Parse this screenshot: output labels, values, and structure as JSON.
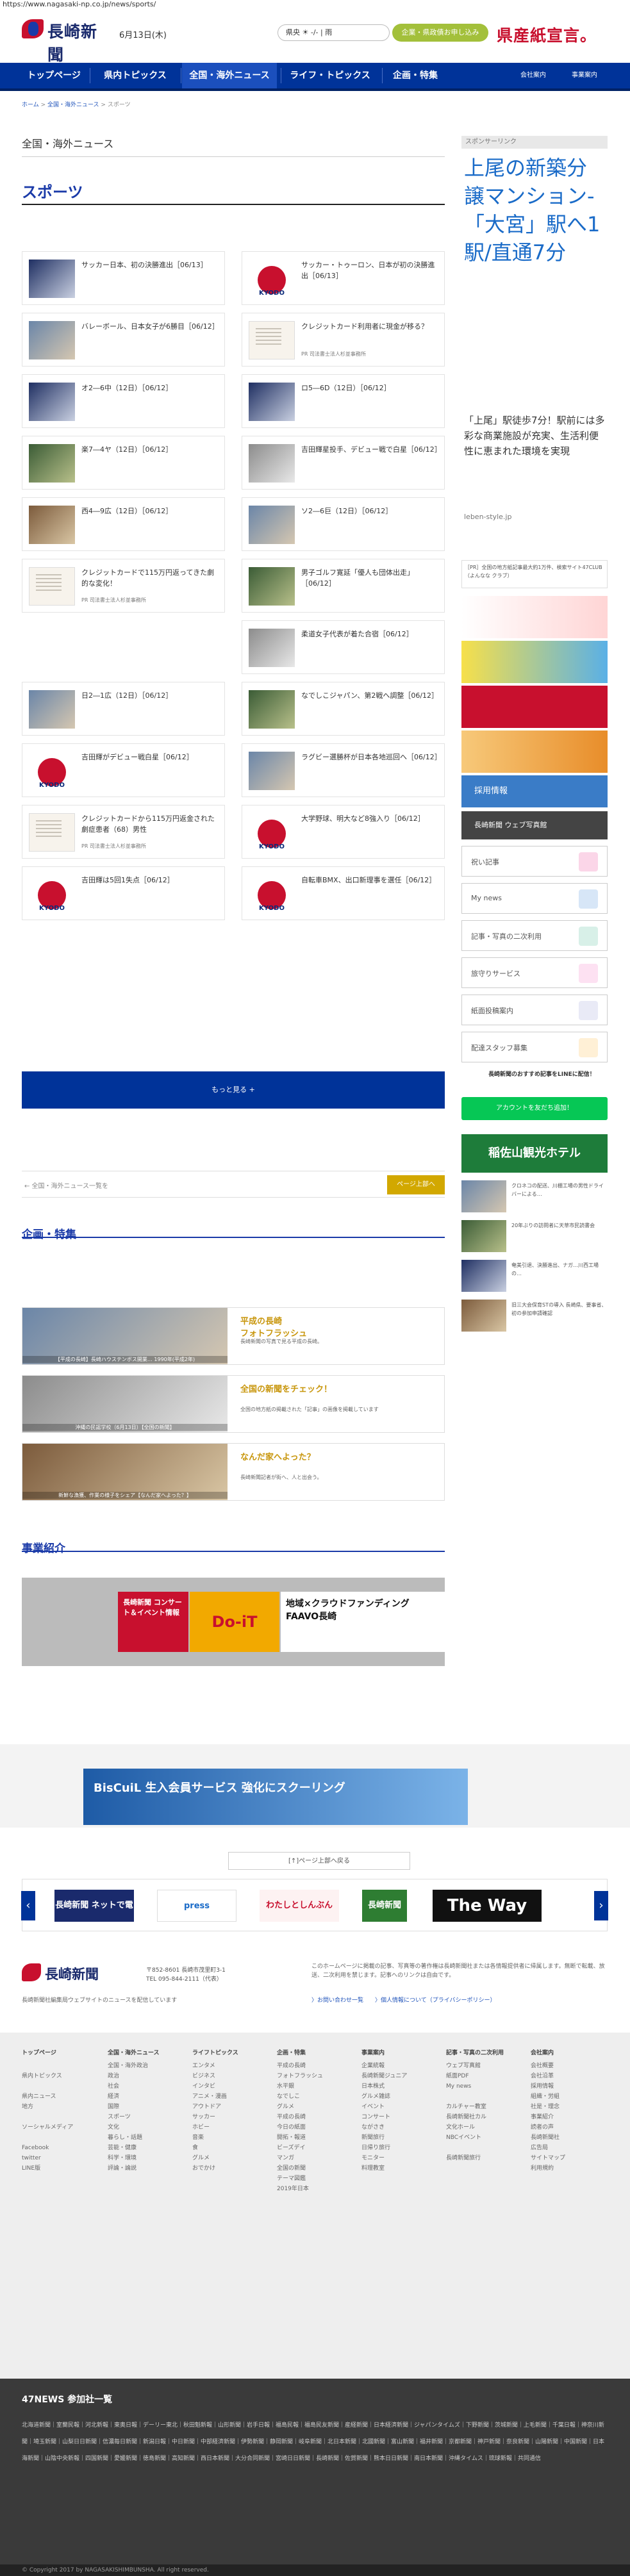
{
  "url": "https://www.nagasaki-np.co.jp/news/sports/",
  "header": {
    "logo_text": "長崎新聞",
    "date": "6月13日(木)",
    "weather": "県央 ☀ -/- | 雨",
    "kigyo_button": "企業・県政債お申し込み",
    "kensan_left": "県産紙",
    "kensan_right": "宣言。"
  },
  "nav": {
    "items": [
      "トップページ",
      "県内トピックス",
      "全国・海外ニュース",
      "ライフ・トピックス",
      "企画・特集"
    ],
    "right": [
      "会社案内",
      "事業案内"
    ]
  },
  "breadcrumb": [
    "ホーム",
    "全国・海外ニュース",
    "スポーツ"
  ],
  "category_label": "全国・海外ニュース",
  "section_title": "スポーツ",
  "cards": [
    {
      "title": "サッカー日本、初の決勝進出［06/13］",
      "sub": ""
    },
    {
      "title": "サッカー・トゥーロン、日本が初の決勝進出［06/13］",
      "sub": ""
    },
    {
      "title": "バレーボール、日本女子が6勝目［06/12］",
      "sub": ""
    },
    {
      "title": "クレジットカード利用者に現金が移る？",
      "sub": "PR 司法書士法人杉並事務所"
    },
    {
      "title": "オ2―6中（12日）［06/12］",
      "sub": ""
    },
    {
      "title": "ロ5―6D（12日）［06/12］",
      "sub": ""
    },
    {
      "title": "楽7―4ヤ（12日）［06/12］",
      "sub": ""
    },
    {
      "title": "吉田輝星投手、デビュー戦で白星［06/12］",
      "sub": ""
    },
    {
      "title": "西4―9広（12日）［06/12］",
      "sub": ""
    },
    {
      "title": "ソ2―6巨（12日）［06/12］",
      "sub": ""
    },
    {
      "title": "クレジットカードで115万円返ってきた劇的な変化！",
      "sub": "PR 司法書士法人杉並事務所"
    },
    {
      "title": "男子ゴルフ寛延「優人も団体出走」［06/12］",
      "sub": ""
    },
    {
      "title": "柔道女子代表が着た合宿［06/12］",
      "sub": ""
    },
    {
      "title": "日2―1広（12日）［06/12］",
      "sub": ""
    },
    {
      "title": "なでしこジャパン、第2戦へ調整［06/12］",
      "sub": ""
    },
    {
      "title": "吉田輝がデビュー戦白星［06/12］",
      "sub": ""
    },
    {
      "title": "ラグビー選勝杯が日本各地巡回へ［06/12］",
      "sub": ""
    },
    {
      "title": "クレジットカードから115万円返金された劇症患者（68）男性",
      "sub": "PR 司法書士法人杉並事務所"
    },
    {
      "title": "大学野球、明大など8強入り［06/12］",
      "sub": ""
    },
    {
      "title": "吉田輝は5回1失点［06/12］",
      "sub": ""
    },
    {
      "title": "自転車BMX、出口新理事を選任［06/12］",
      "sub": ""
    }
  ],
  "kyodo_label": "KYODO",
  "more_button": "もっと見る +",
  "pager": {
    "back": "← 全国・海外ニュース一覧を",
    "up": "ページ上部へ"
  },
  "kikaku": {
    "title": "企画・特集",
    "items": [
      {
        "cap": "【平成の長崎】長崎ハウステンボス開業… 1990年(平成2年)",
        "h": "平成の長崎\nフォトフラッシュ",
        "p": "長崎新聞の写真で見る平成の長崎。"
      },
      {
        "cap": "沖縄の民謡学校（6月13日）【全国の新聞】",
        "h": "全国の新聞をチェック！",
        "p": "全国の地方紙の掲載された「記事」の画像を掲載しています"
      },
      {
        "cap": "新鮮な漁獲、作業の様子をシェア【なんだ家へよった？】",
        "h": "なんだ家へよった？",
        "p": "長崎新聞記者が街へ、人と出会う。"
      }
    ]
  },
  "jigyo": {
    "title": "事業紹介",
    "b1": "長崎新聞 コンサート＆イベント情報",
    "b2": "Do-iT",
    "b3": "地域×クラウドファンディング FAAVO長崎"
  },
  "ad2": "BisCuiL 生入会員サービス 強化にスクーリング",
  "pagetop2": "[↑]ページ上部へ戻る",
  "carousel": [
    "長崎新聞 ネットで電子",
    "press",
    "わたしとしんぶん",
    "長崎新聞",
    "The Way"
  ],
  "footer": {
    "logo": "長崎新聞",
    "addr1": "〒852-8601 長崎市茂里町3-1",
    "addr2": "TEL 095-844-2111（代表）",
    "terms": "長崎新聞社編集局ウェブサイトのニュースを配信しています",
    "note": "このホームページに掲載の記事、写真等の著作権は長崎新聞社または各情報提供者に帰属します。無断で転載、放送、二次利用を禁じます。記事へのリンクは自由です。",
    "links": "〉お問い合わせ一覧　　〉個人情報について（プライバシーポリシー）"
  },
  "sitemap": [
    {
      "h": "トップページ",
      "items": [
        "",
        "県内トピックス",
        "",
        "県内ニュース",
        "地方",
        "",
        "ソーシャルメディア",
        "",
        "Facebook",
        "twitter",
        "LINE版"
      ]
    },
    {
      "h": "全国・海外ニュース",
      "items": [
        "全国・海外政治",
        "政治",
        "社会",
        "経済",
        "国際",
        "スポーツ",
        "文化",
        "暮らし・話題",
        "芸能・健康",
        "科学・環境",
        "評論・論説"
      ]
    },
    {
      "h": "ライフトピックス",
      "items": [
        "エンタメ",
        "ビジネス",
        "インタビ",
        "アニメ・漫画",
        "アウトドア",
        "サッカー",
        "ホビー",
        "音楽",
        "食",
        "グルメ",
        "おでかけ"
      ]
    },
    {
      "h": "企画・特集",
      "items": [
        "平成の長崎",
        "フォトフラッシュ",
        "水平銀",
        "なでしこ",
        "グルメ",
        "平成の長崎",
        "今日の紙面",
        "開拓・報道",
        "ビーズデイ",
        "マンガ",
        "全国の新聞",
        "テーマ図鑑",
        "2019年日本"
      ]
    },
    {
      "h": "事業案内",
      "items": [
        "企業統報",
        "長崎新聞ジュニア",
        "日本株式",
        "グルメ雑誌",
        "イベント",
        "コンサート",
        "ながさき",
        "新聞旅行",
        "日帰り旅行",
        "モニター",
        "料理教室"
      ]
    },
    {
      "h": "記事・写真の二次利用",
      "items": [
        "ウェブ写真館",
        "紙面PDF",
        "My news",
        "",
        "カルチャー教室",
        "長崎新聞社カル",
        "文化ホール",
        "NBCイベント",
        "",
        "長崎新聞旅行"
      ]
    },
    {
      "h": "会社案内",
      "items": [
        "会社概要",
        "会社沿革",
        "採用情報",
        "組織・労組",
        "社是・理念",
        "事業紹介",
        "読者の声",
        "長崎新聞社",
        "広告局",
        "サイトマップ",
        "利用規約"
      ]
    }
  ],
  "news47": {
    "title": "47NEWS 参加社一覧",
    "list": "北海道新聞｜室蘭民報｜河北新報｜東奥日報｜デーリー東北｜秋田魁新報｜山形新聞｜岩手日報｜福島民報｜福島民友新聞｜産経新聞｜日本経済新聞｜ジャパンタイムズ｜下野新聞｜茨城新聞｜上毛新聞｜千葉日報｜神奈川新聞｜埼玉新聞｜山梨日日新聞｜信濃毎日新聞｜新潟日報｜中日新聞｜中部経済新聞｜伊勢新聞｜静岡新聞｜岐阜新聞｜北日本新聞｜北國新聞｜富山新聞｜福井新聞｜京都新聞｜神戸新聞｜奈良新聞｜山陽新聞｜中国新聞｜日本海新聞｜山陰中央新報｜四国新聞｜愛媛新聞｜徳島新聞｜高知新聞｜西日本新聞｜大分合同新聞｜宮崎日日新聞｜長崎新聞｜佐賀新聞｜熊本日日新聞｜南日本新聞｜沖縄タイムス｜琉球新報｜共同通信"
  },
  "copyright": "© Copyright 2017 by NAGASAKISHIMBUNSHA. All right reserved.",
  "side": {
    "sponsor": "スポンサーリンク",
    "ad_big": "上尾の新築分譲マンション-「大宮」駅へ1駅/直通7分",
    "ad_body": "「上尾」駅徒歩7分！駅前には多彩な商業施設が充実、生活利便性に恵まれた環境を実現",
    "ad_url": "leben-style.jp",
    "pr_text": "［PR］全国の地方紙記事最大約1万件、検索サイト47CLUB（よんなな クラブ）",
    "saiyo": "採用情報",
    "web": "長崎新聞 ウェブ写真館",
    "rows": [
      "祝い記事",
      "My news",
      "記事・写真の二次利用",
      "旅守りサービス",
      "紙面投稿案内",
      "配達スタッフ募集"
    ],
    "line_label": "長崎新聞のおすすめ記事をLINEに配信！",
    "line_btn": "アカウントを友だち追加！",
    "hotel": "稲佐山観光ホテル",
    "news": [
      "クロネコの配送、川棚工場の男性ドライバーによる…",
      "20年ぶりの訪問者に天草市民読書会",
      "奄美引退、決勝進出、ナガ…川西工場の…",
      "旧三大会保育STの導入 長崎県、要事省、初の参加申請確認"
    ]
  }
}
